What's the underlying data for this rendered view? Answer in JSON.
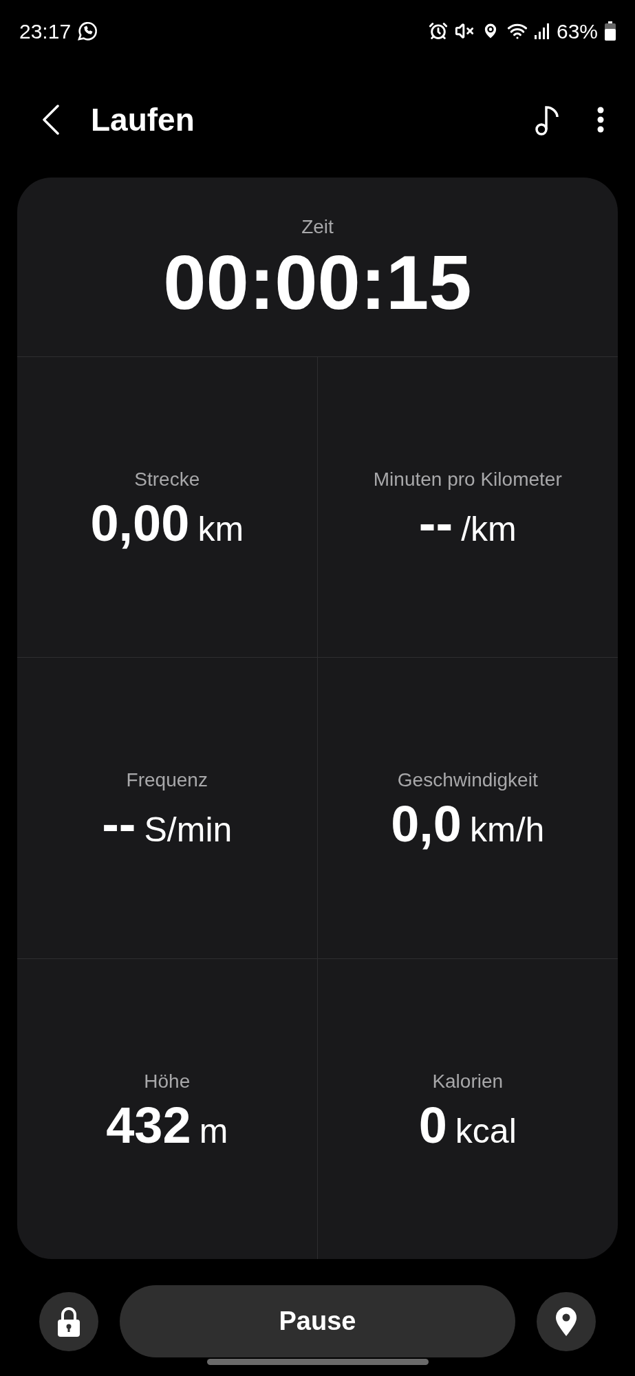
{
  "status_bar": {
    "time": "23:17",
    "battery": "63%"
  },
  "header": {
    "title": "Laufen"
  },
  "time_section": {
    "label": "Zeit",
    "value": "00:00:15"
  },
  "metrics": [
    {
      "label": "Strecke",
      "value": "0,00",
      "unit": "km"
    },
    {
      "label": "Minuten pro Kilometer",
      "value": "--",
      "unit": "/km"
    },
    {
      "label": "Frequenz",
      "value": "--",
      "unit": "S/min"
    },
    {
      "label": "Geschwindigkeit",
      "value": "0,0",
      "unit": "km/h"
    },
    {
      "label": "Höhe",
      "value": "432",
      "unit": "m"
    },
    {
      "label": "Kalorien",
      "value": "0",
      "unit": "kcal"
    }
  ],
  "bottom_bar": {
    "main_button": "Pause"
  }
}
